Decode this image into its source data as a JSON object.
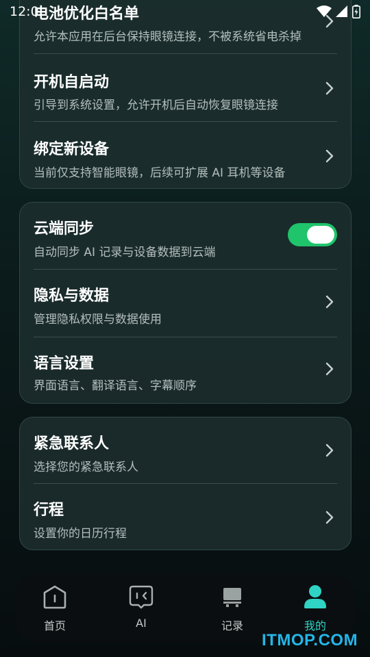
{
  "status_bar": {
    "time": "12:0"
  },
  "card1": {
    "rows": [
      {
        "title": "电池优化白名单",
        "subtitle": "允许本应用在后台保持眼镜连接，不被系统省电杀掉"
      },
      {
        "title": "开机自启动",
        "subtitle": "引导到系统设置，允许开机后自动恢复眼镜连接"
      },
      {
        "title": "绑定新设备",
        "subtitle": "当前仅支持智能眼镜，后续可扩展 AI 耳机等设备"
      }
    ]
  },
  "card2": {
    "rows": [
      {
        "title": "云端同步",
        "subtitle": "自动同步 AI 记录与设备数据到云端",
        "toggle_on": true
      },
      {
        "title": "隐私与数据",
        "subtitle": "管理隐私权限与数据使用"
      },
      {
        "title": "语言设置",
        "subtitle": "界面语言、翻译语言、字幕顺序"
      }
    ]
  },
  "card3": {
    "rows": [
      {
        "title": "紧急联系人",
        "subtitle": "选择您的紧急联系人"
      },
      {
        "title": "行程",
        "subtitle": "设置你的日历行程"
      }
    ]
  },
  "bottom_nav": {
    "items": [
      {
        "label": "首页",
        "icon": "home-icon"
      },
      {
        "label": "AI",
        "icon": "glasses-icon"
      },
      {
        "label": "记录",
        "icon": "records-icon"
      },
      {
        "label": "我的",
        "icon": "profile-icon",
        "active": true
      }
    ],
    "active_color": "#2fd4c4"
  },
  "watermark": "ITMOP.COM",
  "colors": {
    "card_bg": "#1c2e2e",
    "toggle_on": "#1fc46b",
    "subtitle": "#b3bfbd"
  }
}
